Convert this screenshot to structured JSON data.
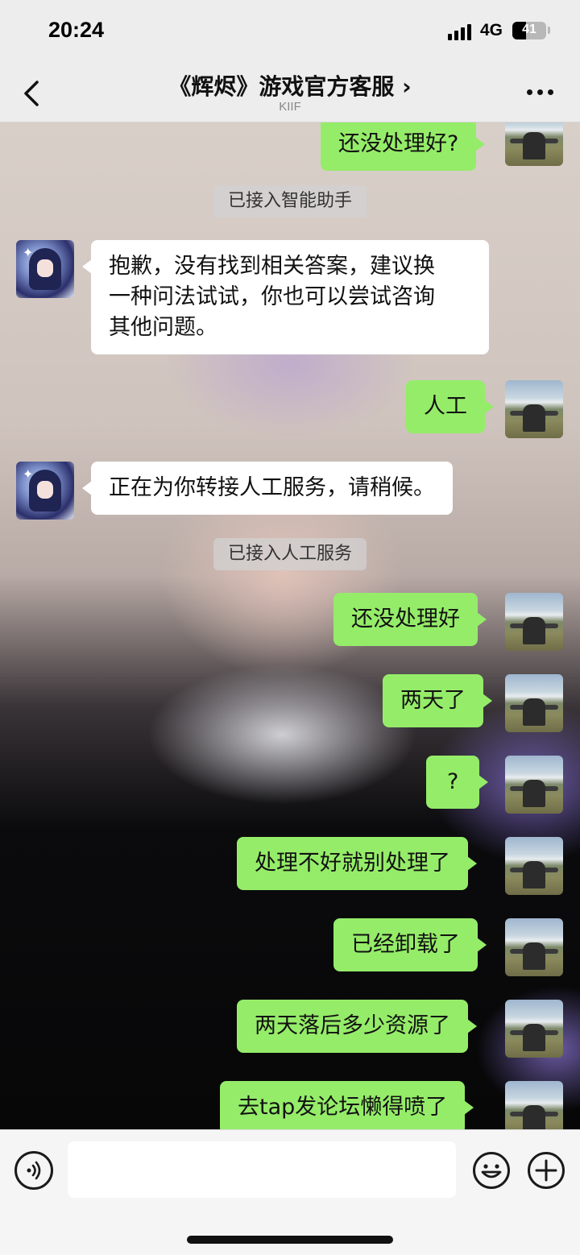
{
  "status_bar": {
    "time": "20:24",
    "network": "4G",
    "battery_level": "41",
    "battery_fraction": 0.41
  },
  "nav": {
    "title": "《辉烬》游戏官方客服 ›",
    "subtitle": "KIIF",
    "back_icon": "chevron-left-icon",
    "more_icon": "more-dots-icon"
  },
  "messages": [
    {
      "kind": "out",
      "text": "还没处理好?"
    },
    {
      "kind": "system",
      "text": "已接入智能助手"
    },
    {
      "kind": "in",
      "lines": [
        "抱歉，没有找到相关答案，建议换",
        "一种问法试试，你也可以尝试咨询",
        "其他问题。"
      ]
    },
    {
      "kind": "out",
      "text": "人工"
    },
    {
      "kind": "in",
      "lines": [
        "正在为你转接人工服务，请稍候。"
      ]
    },
    {
      "kind": "system",
      "text": "已接入人工服务"
    },
    {
      "kind": "out",
      "text": "还没处理好"
    },
    {
      "kind": "out",
      "text": "两天了"
    },
    {
      "kind": "out",
      "text": "?"
    },
    {
      "kind": "out",
      "text": "处理不好就别处理了"
    },
    {
      "kind": "out",
      "text": "已经卸载了"
    },
    {
      "kind": "out",
      "text": "两天落后多少资源了"
    },
    {
      "kind": "out",
      "text": "去tap发论坛懒得喷了"
    }
  ],
  "input_bar": {
    "voice_icon": "voice-icon",
    "text_value": "",
    "emoji_icon": "emoji-icon",
    "plus_icon": "plus-icon"
  },
  "colors": {
    "outgoing_bubble": "#95ec69",
    "incoming_bubble": "#ffffff",
    "bar_background": "#ededed"
  }
}
